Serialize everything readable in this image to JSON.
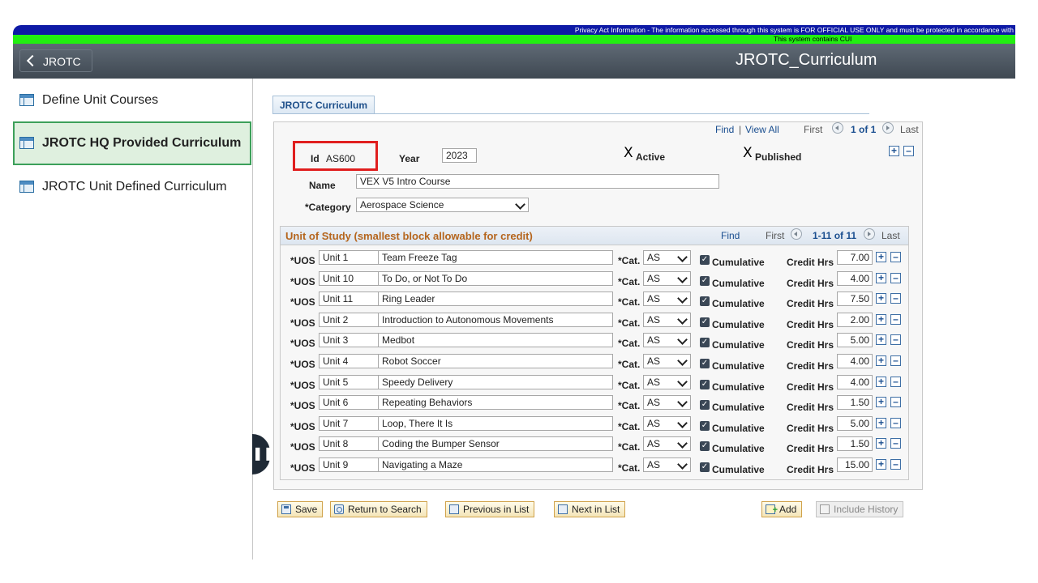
{
  "banner": {
    "privacy": "Privacy Act Information - The information accessed through this system is FOR OFFICIAL USE ONLY and must be protected in accordance with",
    "cui": "This system contains CUI"
  },
  "header": {
    "back_label": "JROTC",
    "title": "JROTC_Curriculum"
  },
  "sidebar": {
    "items": [
      {
        "label": "Define Unit Courses",
        "active": false
      },
      {
        "label": "JROTC HQ Provided Curriculum",
        "active": true
      },
      {
        "label": "JROTC Unit Defined Curriculum",
        "active": false
      }
    ]
  },
  "tab": {
    "label": "JROTC Curriculum"
  },
  "record_nav": {
    "find": "Find",
    "sep": "|",
    "view_all": "View All",
    "first": "First",
    "count": "1 of 1",
    "last": "Last"
  },
  "form": {
    "id_label": "Id",
    "id_value": "AS600",
    "year_label": "Year",
    "year_value": "2023",
    "active_mark": "X",
    "active_label": "Active",
    "published_mark": "X",
    "published_label": "Published",
    "name_label": "Name",
    "name_value": "VEX V5 Intro Course",
    "category_label": "*Category",
    "category_value": "Aerospace Science"
  },
  "units": {
    "title": "Unit of Study (smallest block allowable for credit)",
    "find": "Find",
    "first": "First",
    "count": "1-11 of 11",
    "last": "Last",
    "uos_label": "*UOS",
    "cat_label": "*Cat.",
    "cumulative_label": "Cumulative",
    "credit_label": "Credit Hrs",
    "rows": [
      {
        "uos": "Unit 1",
        "desc": "Team Freeze Tag",
        "cat": "AS",
        "hours": "7.00"
      },
      {
        "uos": "Unit 10",
        "desc": "To Do, or Not To Do",
        "cat": "AS",
        "hours": "4.00"
      },
      {
        "uos": "Unit 11",
        "desc": "Ring Leader",
        "cat": "AS",
        "hours": "7.50"
      },
      {
        "uos": "Unit 2",
        "desc": "Introduction to Autonomous Movements",
        "cat": "AS",
        "hours": "2.00"
      },
      {
        "uos": "Unit 3",
        "desc": "Medbot",
        "cat": "AS",
        "hours": "5.00"
      },
      {
        "uos": "Unit 4",
        "desc": "Robot Soccer",
        "cat": "AS",
        "hours": "4.00"
      },
      {
        "uos": "Unit 5",
        "desc": "Speedy Delivery",
        "cat": "AS",
        "hours": "4.00"
      },
      {
        "uos": "Unit 6",
        "desc": "Repeating Behaviors",
        "cat": "AS",
        "hours": "1.50"
      },
      {
        "uos": "Unit 7",
        "desc": "Loop, There It Is",
        "cat": "AS",
        "hours": "5.00"
      },
      {
        "uos": "Unit 8",
        "desc": "Coding the Bumper Sensor",
        "cat": "AS",
        "hours": "1.50"
      },
      {
        "uos": "Unit 9",
        "desc": "Navigating a Maze",
        "cat": "AS",
        "hours": "15.00"
      }
    ]
  },
  "actions": {
    "save": "Save",
    "return": "Return to Search",
    "previous": "Previous in List",
    "next": "Next in List",
    "add": "Add",
    "history": "Include History"
  },
  "colors": {
    "banner_blue": "#0e1aa6",
    "banner_green": "#22ef11",
    "active_green": "#3ca05a",
    "highlight_red": "#e01e1e",
    "link_blue": "#1b4f90"
  }
}
